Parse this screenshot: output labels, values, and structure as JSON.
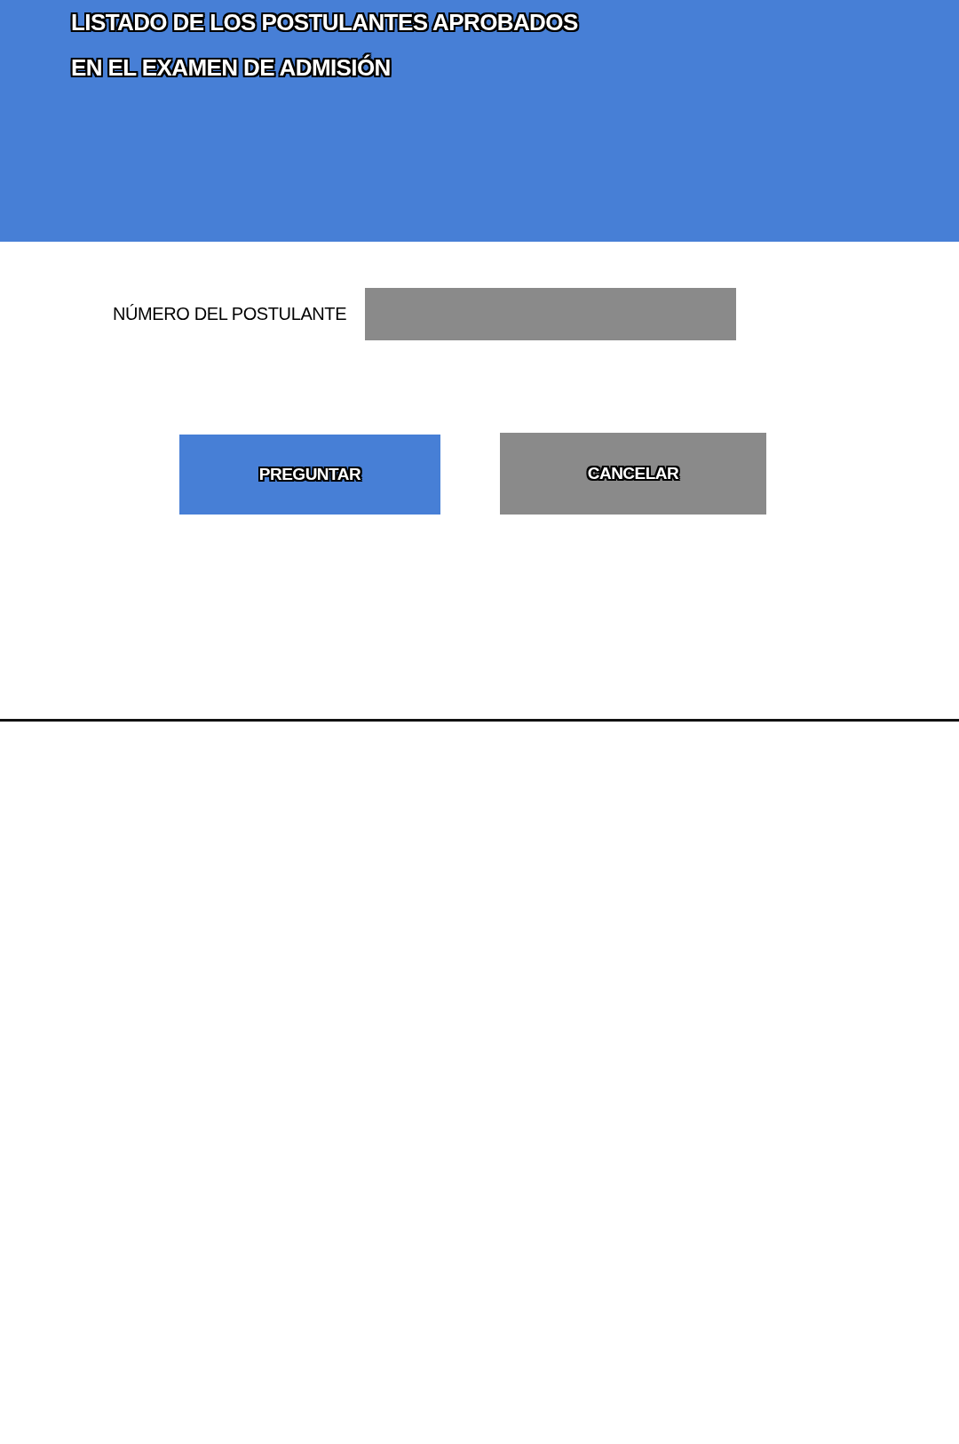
{
  "header": {
    "title_lines": [
      "LISTADO DE LOS POSTULANTES APROBADOS",
      "EN EL EXAMEN DE ADMISIÓN"
    ]
  },
  "form": {
    "label": "NÚMERO DEL POSTULANTE"
  },
  "buttons": [
    {
      "label": "PREGUNTAR",
      "kind": "primary"
    },
    {
      "label": "CANCELAR",
      "kind": "secondary"
    }
  ]
}
